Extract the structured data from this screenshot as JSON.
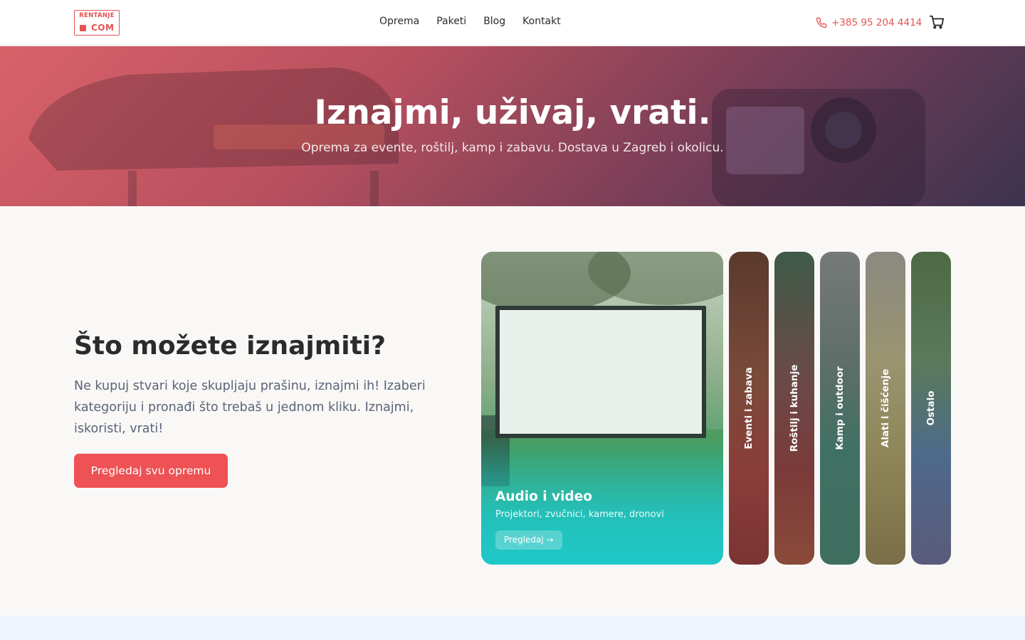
{
  "header": {
    "logo": {
      "top": "RENTANJE",
      "bottom": "COM"
    },
    "nav": [
      "Oprema",
      "Paketi",
      "Blog",
      "Kontakt"
    ],
    "phone": "+385 95 204 4414",
    "icons": {
      "phone": "phone-icon",
      "cart": "cart-icon"
    },
    "accent": "#e45252"
  },
  "hero": {
    "title": "Iznajmi, uživaj, vrati.",
    "subtitle": "Oprema za evente, roštilj, kamp i zabavu. Dostava u Zagreb i okolicu."
  },
  "main": {
    "title": "Što možete iznajmiti?",
    "description": "Ne kupuj stvari koje skupljaju prašinu, iznajmi ih! Izaberi kategoriju i pronađi što trebaš u jednom kliku. Iznajmi, iskoristi, vrati!",
    "cta": "Pregledaj svu opremu",
    "cta_color": "#ee5255"
  },
  "categories": {
    "active": {
      "title": "Audio i video",
      "subtitle": "Projektori, zvučnici, kamere, dronovi",
      "button": "Pregledaj →"
    },
    "items": [
      "Eventi i zabava",
      "Roštilj i kuhanje",
      "Kamp i outdoor",
      "Alati i čišćenje",
      "Ostalo"
    ]
  }
}
